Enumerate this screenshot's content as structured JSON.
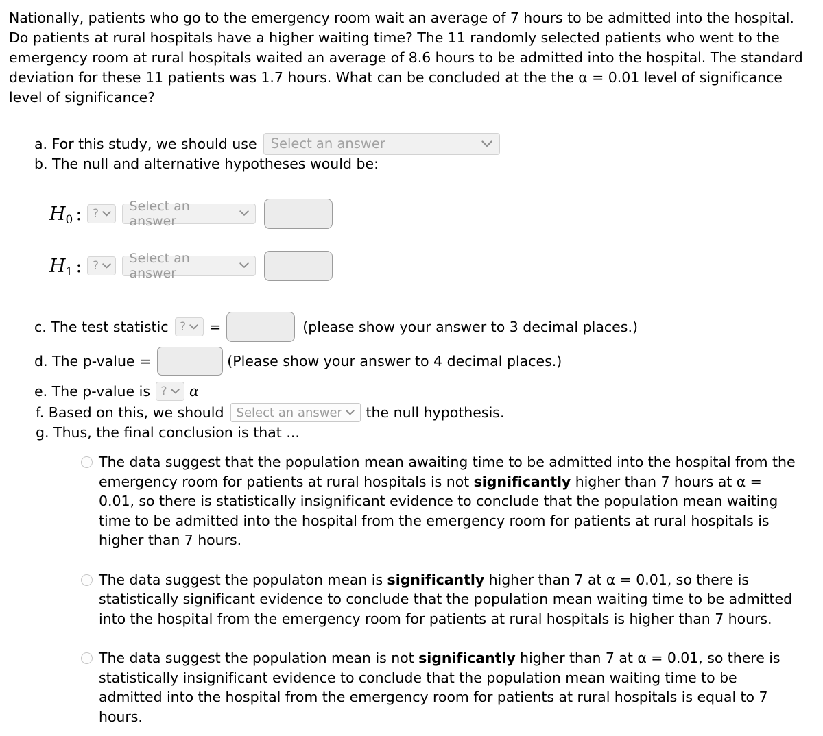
{
  "problem": {
    "text": "Nationally, patients who go to the emergency room wait an average of 7 hours to be admitted into the hospital. Do patients at rural hospitals have a higher waiting time? The 11 randomly selected patients who went to the emergency room at rural hospitals waited an average of 8.6 hours to be admitted into the hospital. The standard deviation for these 11 patients was 1.7 hours. What can be concluded at the the α = 0.01 level of significance level of significance?"
  },
  "parts": {
    "a_label": "a. For this study, we should use",
    "b_label": "b. The null and alternative hypotheses would be:",
    "c_label": "c. The test statistic",
    "c_equals": "=",
    "c_note": "(please show your answer to 3 decimal places.)",
    "d_label": "d. The p-value =",
    "d_note": "(Please show your answer to 4 decimal places.)",
    "e_label": "e. The p-value is",
    "e_alpha": "α",
    "f_label_before": "f. Based on this, we should",
    "f_label_after": "the null hypothesis.",
    "g_label": "g. Thus, the final conclusion is that ..."
  },
  "hypotheses": {
    "h0_symbol": "H",
    "h0_sub": "0",
    "h1_symbol": "H",
    "h1_sub": "1",
    "colon": ":",
    "q_placeholder": "?",
    "answer_placeholder": "Select an answer",
    "value_placeholder": ""
  },
  "selects": {
    "study_placeholder": "Select an answer",
    "decision_placeholder": "Select an answer",
    "chevron": "⌄",
    "chevron_glyph": "▾"
  },
  "conclusion_options": [
    {
      "id": "option-1",
      "segments": [
        {
          "text": "The data suggest that the population mean awaiting time to be admitted into the hospital from the emergency room for patients at rural hospitals is not ",
          "bold": false
        },
        {
          "text": "significantly",
          "bold": true
        },
        {
          "text": " higher than 7 hours at α = 0.01, so there is statistically insignificant evidence to conclude that the population mean waiting time to be admitted into the hospital from the emergency room for patients at rural hospitals is higher than 7 hours.",
          "bold": false
        }
      ]
    },
    {
      "id": "option-2",
      "segments": [
        {
          "text": "The data suggest the populaton mean is ",
          "bold": false
        },
        {
          "text": "significantly",
          "bold": true
        },
        {
          "text": " higher than 7 at α = 0.01, so there is statistically significant evidence to conclude that the population mean waiting time to be admitted into the hospital from the emergency room for patients at rural hospitals is higher than 7 hours.",
          "bold": false
        }
      ]
    },
    {
      "id": "option-3",
      "segments": [
        {
          "text": "The data suggest the population mean is not ",
          "bold": false
        },
        {
          "text": "significantly",
          "bold": true
        },
        {
          "text": " higher than 7 at α = 0.01, so there is statistically insignificant evidence to conclude that the population mean waiting time to be admitted into the hospital from the emergency room for patients at rural hospitals is equal to 7 hours.",
          "bold": false
        }
      ]
    }
  ],
  "colors": {
    "text": "#000000",
    "placeholder": "#9b9b9b",
    "input_fill": "#ececec",
    "input_border": "#9c9c9c",
    "select_fill": "#f1f1f1",
    "select_border": "#d6d6d6",
    "radio_border": "#c5c5c5",
    "background": "#ffffff"
  }
}
